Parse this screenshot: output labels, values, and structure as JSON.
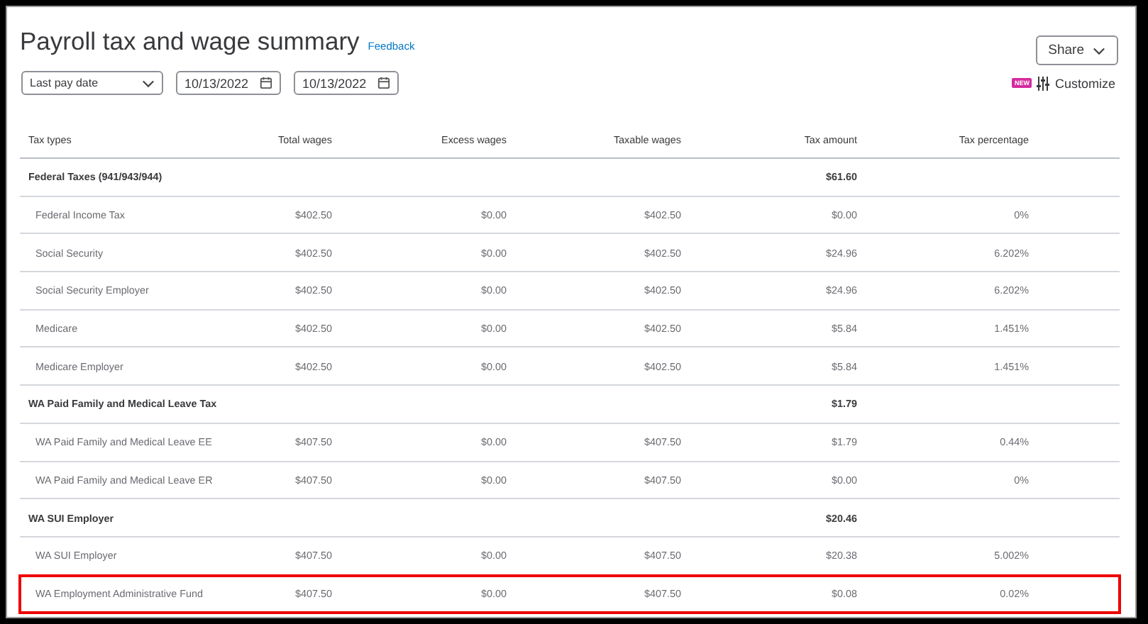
{
  "header": {
    "title": "Payroll tax and wage summary",
    "feedback_link": "Feedback",
    "share_button": "Share",
    "new_badge": "NEW",
    "customize_link": "Customize"
  },
  "filters": {
    "period": "Last pay date",
    "start_date": "10/13/2022",
    "end_date": "10/13/2022"
  },
  "table": {
    "columns": [
      "Tax types",
      "Total wages",
      "Excess wages",
      "Taxable wages",
      "Tax amount",
      "Tax percentage"
    ],
    "rows": [
      {
        "kind": "group",
        "highlighted": false,
        "cells": [
          "Federal Taxes (941/943/944)",
          "",
          "",
          "",
          "$61.60",
          ""
        ]
      },
      {
        "kind": "item",
        "highlighted": false,
        "cells": [
          "Federal Income Tax",
          "$402.50",
          "$0.00",
          "$402.50",
          "$0.00",
          "0%"
        ]
      },
      {
        "kind": "item",
        "highlighted": false,
        "cells": [
          "Social Security",
          "$402.50",
          "$0.00",
          "$402.50",
          "$24.96",
          "6.202%"
        ]
      },
      {
        "kind": "item",
        "highlighted": false,
        "cells": [
          "Social Security Employer",
          "$402.50",
          "$0.00",
          "$402.50",
          "$24.96",
          "6.202%"
        ]
      },
      {
        "kind": "item",
        "highlighted": false,
        "cells": [
          "Medicare",
          "$402.50",
          "$0.00",
          "$402.50",
          "$5.84",
          "1.451%"
        ]
      },
      {
        "kind": "item",
        "highlighted": false,
        "cells": [
          "Medicare Employer",
          "$402.50",
          "$0.00",
          "$402.50",
          "$5.84",
          "1.451%"
        ]
      },
      {
        "kind": "group",
        "highlighted": false,
        "cells": [
          "WA Paid Family and Medical Leave Tax",
          "",
          "",
          "",
          "$1.79",
          ""
        ]
      },
      {
        "kind": "item",
        "highlighted": false,
        "cells": [
          "WA Paid Family and Medical Leave EE",
          "$407.50",
          "$0.00",
          "$407.50",
          "$1.79",
          "0.44%"
        ]
      },
      {
        "kind": "item",
        "highlighted": false,
        "cells": [
          "WA Paid Family and Medical Leave ER",
          "$407.50",
          "$0.00",
          "$407.50",
          "$0.00",
          "0%"
        ]
      },
      {
        "kind": "group",
        "highlighted": false,
        "cells": [
          "WA SUI Employer",
          "",
          "",
          "",
          "$20.46",
          ""
        ]
      },
      {
        "kind": "item",
        "highlighted": false,
        "cells": [
          "WA SUI Employer",
          "$407.50",
          "$0.00",
          "$407.50",
          "$20.38",
          "5.002%"
        ]
      },
      {
        "kind": "item",
        "highlighted": true,
        "cells": [
          "WA Employment Administrative Fund",
          "$407.50",
          "$0.00",
          "$407.50",
          "$0.08",
          "0.02%"
        ]
      }
    ]
  }
}
